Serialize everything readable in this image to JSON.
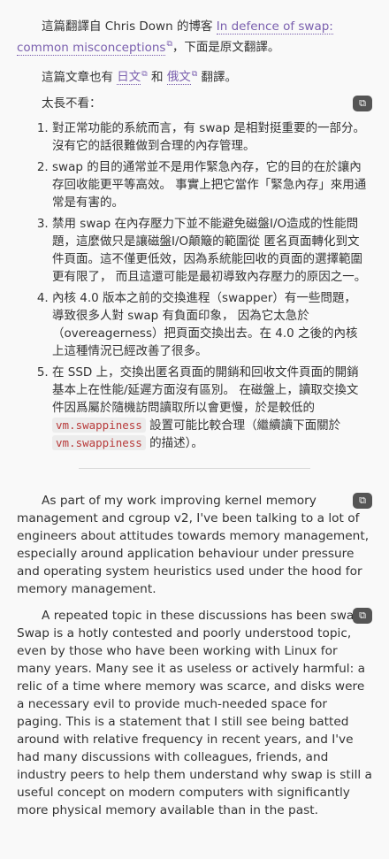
{
  "intro": {
    "prefix": "這篇翻譯自 Chris Down 的博客 ",
    "source_link": "In defence of swap: common misconceptions",
    "suffix": "，下面是原文翻譯。"
  },
  "also": {
    "prefix": "這篇文章也有 ",
    "link_jp": "日文",
    "middle": " 和 ",
    "link_ru": "俄文",
    "suffix": " 翻譯。"
  },
  "tldr_label": "太長不看：",
  "list": {
    "item1": "對正常功能的系統而言，有 swap 是相對挺重要的一部分。沒有它的話很難做到合理的內存管理。",
    "item2": "swap 的目的通常並不是用作緊急內存，它的目的在於讓內存回收能更平等高效。 事實上把它當作「緊急內存」來用通常是有害的。",
    "item3": "禁用 swap 在內存壓力下並不能避免磁盤I/O造成的性能問題，這麼做只是讓磁盤I/O顛簸的範圍從 匿名頁面轉化到文件頁面。這不僅更低效，因為系統能回收的頁面的選擇範圍更有限了， 而且這還可能是最初導致內存壓力的原因之一。",
    "item4": "內核 4.0 版本之前的交換進程（swapper）有一些問題，導致很多人對 swap 有負面印象， 因為它太急於（overeagerness）把頁面交換出去。在 4.0 之後的內核上這種情況已經改善了很多。",
    "item5_a": "在 SSD 上，交換出匿名頁面的開銷和回收文件頁面的開銷基本上在性能/延遲方面沒有區別。 在磁盤上，讀取交換文件因爲屬於隨機訪問讀取所以會更慢，於是較低的 ",
    "item5_code1": "vm.swappiness",
    "item5_b": " 設置可能比較合理（繼續讀下面關於 ",
    "item5_code2": "vm.swappiness",
    "item5_c": " 的描述）。"
  },
  "en": {
    "p1": "As part of my work improving kernel memory management and cgroup v2, I've been talking to a lot of engineers about attitudes towards memory management, especially around application behaviour under pressure and operating system heuristics used under the hood for memory management.",
    "p2": "A repeated topic in these discussions has been swap. Swap is a hotly contested and poorly understood topic, even by those who have been working with Linux for many years. Many see it as useless or actively harmful: a relic of a time where memory was scarce, and disks were a necessary evil to provide much-needed space for paging. This is a statement that I still see being batted around with relative frequency in recent years, and I've had many discussions with colleagues, friends, and industry peers to help them understand why swap is still a useful concept on modern computers with significantly more physical memory available than in the past."
  },
  "icons": {
    "translate": "translate-icon"
  },
  "colors": {
    "link": "#7a5fae",
    "code": "#b83a3a",
    "icon_bg": "#555555"
  }
}
